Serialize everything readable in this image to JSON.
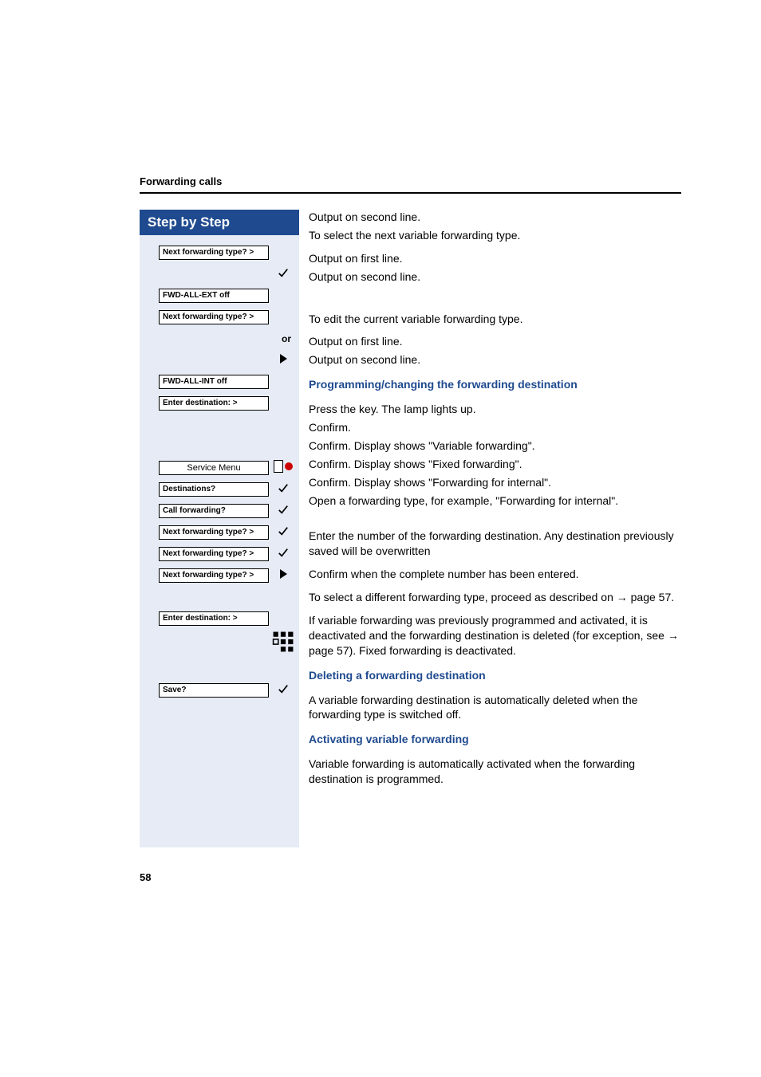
{
  "header": {
    "running": "Forwarding calls"
  },
  "left": {
    "title": "Step by Step",
    "or": "or",
    "items": {
      "next1": "Next forwarding type?  >",
      "fwd_ext_off": "FWD-ALL-EXT off",
      "next2": "Next forwarding type?  >",
      "fwd_int_off": "FWD-ALL-INT off",
      "enter_dest1": "Enter destination:      >",
      "service_menu": "Service Menu",
      "destinations": "Destinations?",
      "call_fwd": "Call forwarding?",
      "next3": "Next forwarding type?  >",
      "next4": "Next forwarding type?  >",
      "next5": "Next forwarding type?  >",
      "enter_dest2": "Enter destination:      >",
      "save": "Save?"
    }
  },
  "right": {
    "p1": "Output on second line.",
    "p2": "To select the next variable forwarding type.",
    "p3": "Output on first line.",
    "p4": "Output on second line.",
    "p5": "To edit the current variable forwarding type.",
    "p6": "Output on first line.",
    "p7": "Output on second line.",
    "h1": "Programming/changing the forwarding destination",
    "p8": "Press the key. The lamp lights up.",
    "p9": "Confirm.",
    "p10": "Confirm. Display shows \"Variable forwarding\".",
    "p11": "Confirm. Display shows \"Fixed forwarding\".",
    "p12": "Confirm. Display shows \"Forwarding for internal\".",
    "p13": "Open a forwarding type, for example, \"Forwarding for internal\".",
    "p14": "Enter the number of the forwarding destination. Any destination previously saved will be overwritten",
    "p15": "Confirm when the complete number has been entered.",
    "p16a": "To select a different forwarding type, proceed as described on ",
    "p16b": " page 57.",
    "p17a": "If variable forwarding was previously programmed and activated, it is deactivated and the forwarding destination is deleted (for exception, see ",
    "p17b": " page 57). Fixed forwarding is deactivated.",
    "h2": "Deleting a forwarding destination",
    "p18": "A variable forwarding destination is automatically deleted when the forwarding type is switched off.",
    "h3": "Activating variable forwarding",
    "p19": "Variable forwarding is automatically activated when the forwarding destination is programmed."
  },
  "page_number": "58"
}
